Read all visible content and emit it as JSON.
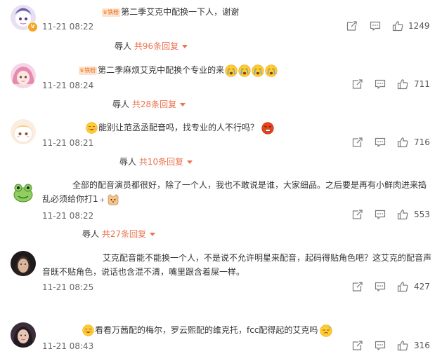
{
  "comments": [
    {
      "tag": "铁粉",
      "text": "第二季艾克中配换一下人，谢谢",
      "time": "11-21 08:22",
      "likes": "1249",
      "replies": {
        "user": "辱人",
        "count_text": "共96条回复"
      }
    },
    {
      "tag": "铁粉",
      "text": "第二季麻烦艾克中配换个专业的来",
      "time": "11-21 08:24",
      "likes": "711",
      "replies": {
        "user": "辱人",
        "count_text": "共28条回复"
      }
    },
    {
      "text": "能别让范丞丞配音吗，找专业的人不行吗？",
      "time": "11-21 08:21",
      "likes": "716",
      "replies": {
        "user": "辱人",
        "count_text": "共10条回复"
      }
    },
    {
      "text_line1": "全部的配音演员都很好，除了一个人，我也不敢说是谁，大家细品。之后要是再有小鲜肉进来捣",
      "text_line2": "乱必须给你打1",
      "time": "11-21 08:22",
      "likes": "553",
      "replies": {
        "user": "辱人",
        "count_text": "共27条回复"
      }
    },
    {
      "text_line1": "艾克配音能不能换一个人，不是说不允许明星来配音，起码得贴角色吧？这艾克的配音声",
      "text_line2": "音既不贴角色，说话也含混不清，嘴里跟含着屎一样。",
      "time": "11-21 08:25",
      "likes": "427"
    },
    {
      "text": "看看万茜配的梅尔，罗云熙配的维克托，fcc配得起的艾克吗",
      "time": "11-21 08:43",
      "likes": "316"
    }
  ],
  "icons": {
    "share": "share-icon",
    "comment": "comment-icon",
    "like": "thumbs-up-icon",
    "verified": "verified-badge-icon"
  },
  "colors": {
    "accent": "#eb7350",
    "tag_bg": "#fde3cf",
    "tag_text": "#e86b1d",
    "text": "#333333",
    "muted": "#666666"
  }
}
